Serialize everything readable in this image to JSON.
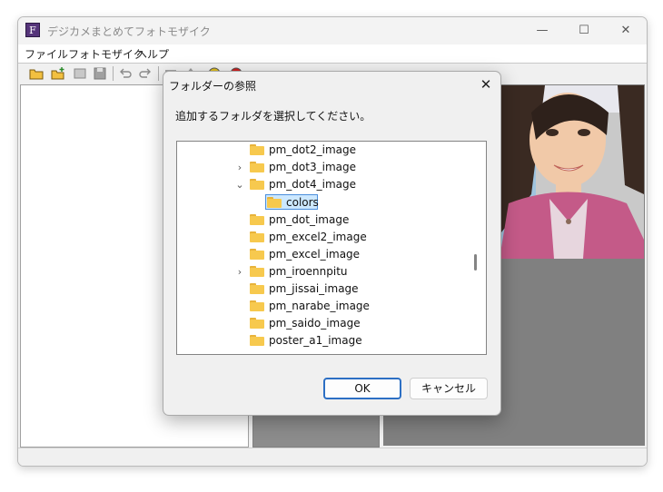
{
  "app": {
    "title": "デジカメまとめてフォトモザイク",
    "icon_letter": "F",
    "caption": {
      "minimize": "—",
      "maximize": "☐",
      "close": "✕"
    }
  },
  "menu": [
    "ファイル",
    "フォトモザイク",
    "ヘルプ"
  ],
  "toolbar_icons": [
    "open-folder-icon",
    "new-folder-icon",
    "image-icon",
    "save-icon",
    "undo-icon",
    "redo-icon",
    "list-icon",
    "sort-icon",
    "help-icon",
    "info-icon"
  ],
  "dialog": {
    "title": "フォルダーの参照",
    "close": "✕",
    "message": "追加するフォルダを選択してください。",
    "tree": [
      {
        "label": "pm_dot2_image",
        "expander": ""
      },
      {
        "label": "pm_dot3_image",
        "expander": "›"
      },
      {
        "label": "pm_dot4_image",
        "expander": "⌄"
      },
      {
        "label": "colors",
        "expander": "",
        "child": true,
        "selected": true
      },
      {
        "label": "pm_dot_image",
        "expander": ""
      },
      {
        "label": "pm_excel2_image",
        "expander": ""
      },
      {
        "label": "pm_excel_image",
        "expander": ""
      },
      {
        "label": "pm_iroennpitu",
        "expander": "›"
      },
      {
        "label": "pm_jissai_image",
        "expander": ""
      },
      {
        "label": "pm_narabe_image",
        "expander": ""
      },
      {
        "label": "pm_saido_image",
        "expander": ""
      },
      {
        "label": "poster_a1_image",
        "expander": ""
      }
    ],
    "ok": "OK",
    "cancel": "キャンセル"
  },
  "colors": {
    "accent": "#2c6fc4",
    "selection": "#cce8ff",
    "folder": "#f7c94e"
  }
}
